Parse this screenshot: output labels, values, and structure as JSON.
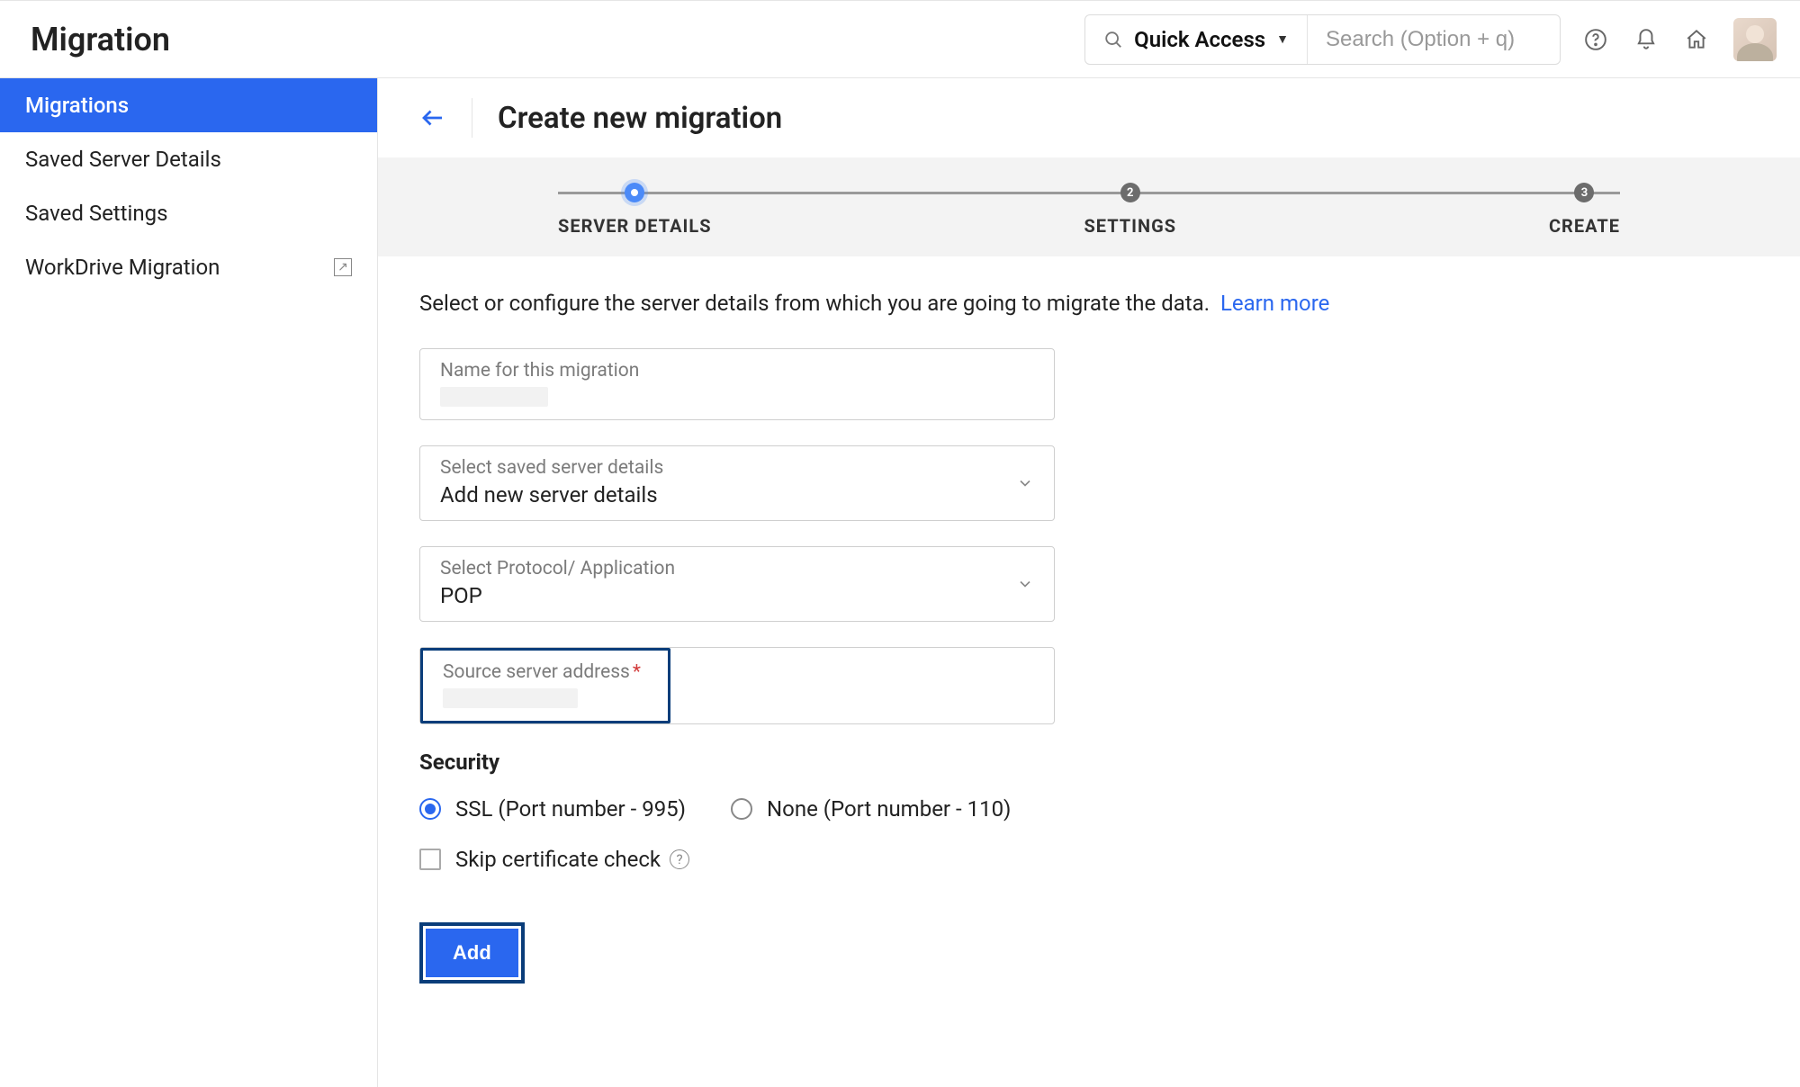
{
  "header": {
    "title": "Migration",
    "quick_access_label": "Quick Access",
    "search_placeholder": "Search (Option + q)"
  },
  "sidebar": {
    "items": [
      {
        "label": "Migrations"
      },
      {
        "label": "Saved Server Details"
      },
      {
        "label": "Saved Settings"
      },
      {
        "label": "WorkDrive Migration"
      }
    ]
  },
  "page": {
    "title": "Create new migration",
    "description": "Select or configure the server details from which you are going to migrate the data.",
    "learn_more": "Learn more"
  },
  "stepper": {
    "steps": [
      {
        "label": "SERVER DETAILS",
        "num": ""
      },
      {
        "label": "SETTINGS",
        "num": "2"
      },
      {
        "label": "CREATE",
        "num": "3"
      }
    ]
  },
  "form": {
    "migration_name": {
      "label": "Name for this migration",
      "value": ""
    },
    "saved_server": {
      "label": "Select saved server details",
      "value": "Add new server details"
    },
    "protocol": {
      "label": "Select Protocol/ Application",
      "value": "POP"
    },
    "source_server": {
      "label": "Source server address",
      "value": "",
      "required": true
    },
    "security": {
      "title": "Security",
      "ssl_label": "SSL (Port number - 995)",
      "none_label": "None (Port number - 110)",
      "skip_cert_label": "Skip certificate check"
    },
    "add_button": "Add"
  }
}
